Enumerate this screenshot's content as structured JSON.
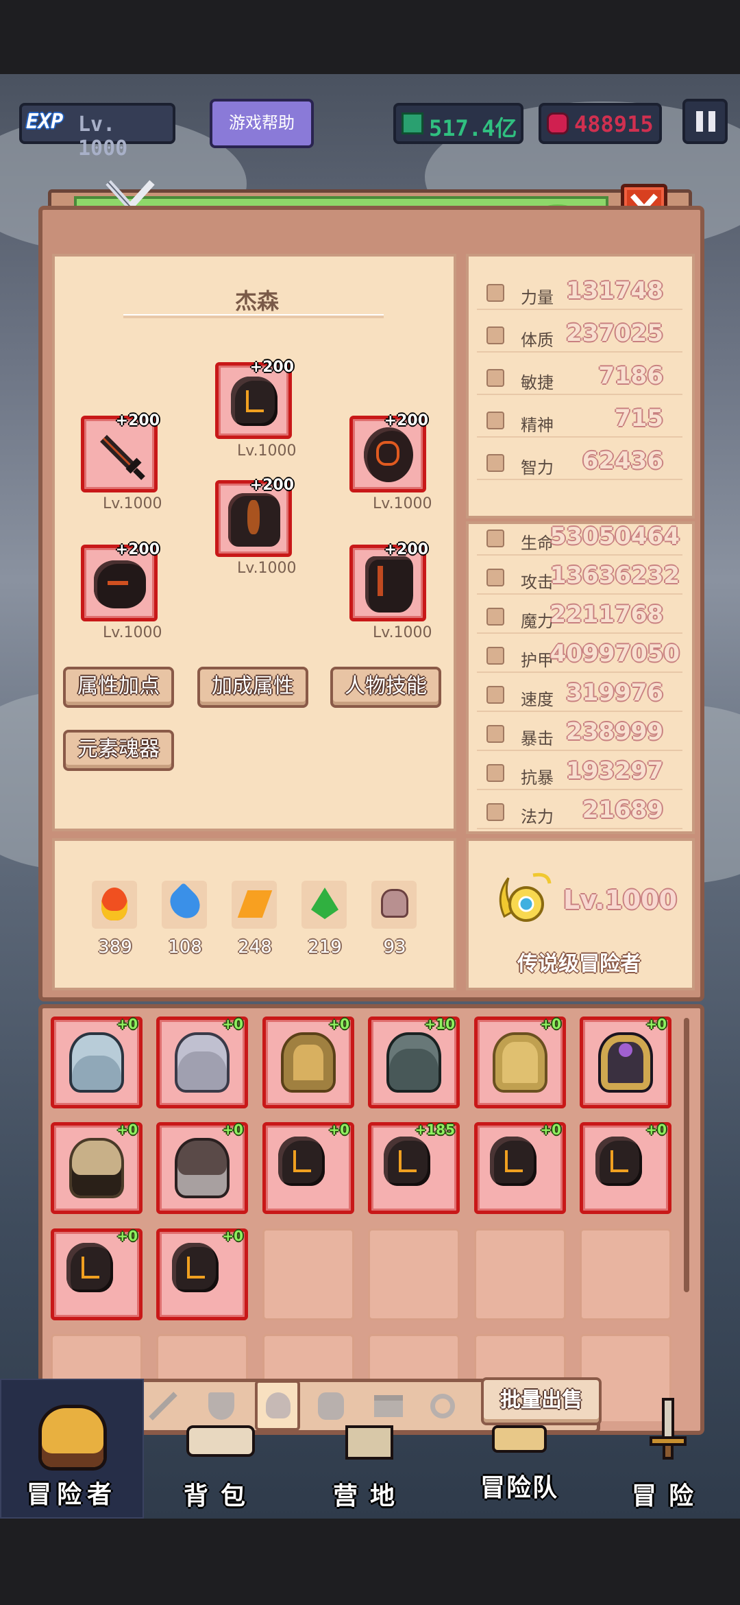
{
  "hud": {
    "exp_badge": "EXP",
    "level": "Lv. 1000",
    "help_button": "游戏帮助",
    "gems": "517.4亿",
    "rubies": "488915",
    "pause_icon": "pause-icon"
  },
  "colors": {
    "slot_border": "#c81818",
    "slot_fill": "#f5b0b0",
    "parchment": "#f8e0c0",
    "title_bar": "#8ed86a",
    "close_button": "#d84020"
  },
  "character": {
    "name": "杰森",
    "equipment": [
      {
        "slot": "helmet",
        "plus": "+200",
        "level": "Lv.1000"
      },
      {
        "slot": "weapon",
        "plus": "+200",
        "level": "Lv.1000"
      },
      {
        "slot": "shield",
        "plus": "+200",
        "level": "Lv.1000"
      },
      {
        "slot": "armor",
        "plus": "+200",
        "level": "Lv.1000"
      },
      {
        "slot": "gloves",
        "plus": "+200",
        "level": "Lv.1000"
      },
      {
        "slot": "boots",
        "plus": "+200",
        "level": "Lv.1000"
      }
    ],
    "buttons": [
      "属性加点",
      "加成属性",
      "人物技能",
      "元素魂器"
    ],
    "elements": [
      {
        "icon": "fire-icon",
        "value": "389"
      },
      {
        "icon": "water-icon",
        "value": "108"
      },
      {
        "icon": "lightning-icon",
        "value": "248"
      },
      {
        "icon": "earth-icon",
        "value": "219"
      },
      {
        "icon": "skull-icon",
        "value": "93"
      }
    ]
  },
  "base_stats": [
    {
      "name": "力量",
      "value": "131748"
    },
    {
      "name": "体质",
      "value": "237025"
    },
    {
      "name": "敏捷",
      "value": "7186"
    },
    {
      "name": "精神",
      "value": "715"
    },
    {
      "name": "智力",
      "value": "62436"
    }
  ],
  "combat_stats": [
    {
      "name": "生命",
      "value": "53050464"
    },
    {
      "name": "攻击",
      "value": "13636232"
    },
    {
      "name": "魔力",
      "value": "2211768"
    },
    {
      "name": "护甲",
      "value": "40997050"
    },
    {
      "name": "速度",
      "value": "319976"
    },
    {
      "name": "暴击",
      "value": "238999"
    },
    {
      "name": "抗暴",
      "value": "193297"
    },
    {
      "name": "法力",
      "value": "21689"
    }
  ],
  "rank": {
    "level": "Lv.1000",
    "title": "传说级冒险者"
  },
  "inventory": [
    {
      "item": "silver-helmet",
      "plus": "+0"
    },
    {
      "item": "horned-helmet",
      "plus": "+0"
    },
    {
      "item": "golden-crown-helmet",
      "plus": "+0"
    },
    {
      "item": "dark-plate-helmet",
      "plus": "+10"
    },
    {
      "item": "golden-winged-helmet",
      "plus": "+0"
    },
    {
      "item": "purple-orb-helmet",
      "plus": "+0"
    },
    {
      "item": "bronze-helmet",
      "plus": "+0"
    },
    {
      "item": "viking-helmet",
      "plus": "+0"
    },
    {
      "item": "lava-helmet",
      "plus": "+0"
    },
    {
      "item": "lava-helmet",
      "plus": "+185"
    },
    {
      "item": "lava-helmet",
      "plus": "+0"
    },
    {
      "item": "lava-helmet",
      "plus": "+0"
    },
    {
      "item": "lava-helmet",
      "plus": "+0"
    },
    {
      "item": "lava-helmet",
      "plus": "+0"
    }
  ],
  "inventory_tabs": [
    "sword-tab-icon",
    "shield-tab-icon",
    "helmet-tab-icon",
    "armor-tab-icon",
    "gloves-tab-icon",
    "ring-tab-icon"
  ],
  "bulk_sell": "批量出售",
  "nav": [
    "冒险者",
    "背包",
    "营地",
    "冒险队",
    "冒险"
  ]
}
